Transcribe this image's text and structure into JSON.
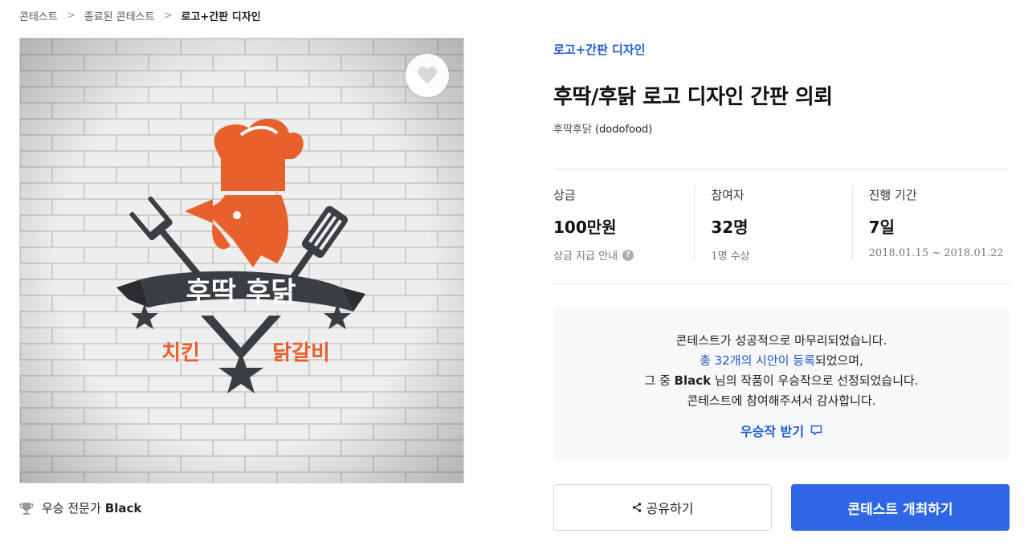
{
  "breadcrumb": {
    "items": [
      "콘테스트",
      "종료된 콘테스트",
      "로고+간판 디자인"
    ]
  },
  "image": {
    "logo_main": "후딱 후닭",
    "logo_left": "치킨",
    "logo_right": "닭갈비"
  },
  "winner": {
    "label": "우승 전문가",
    "name": "Black"
  },
  "contest": {
    "category": "로고+간판 디자인",
    "title": "후딱/후닭 로고 디자인 간판 의뢰",
    "host_name": "후딱후닭",
    "host_id": "(dodofood)"
  },
  "stats": {
    "prize_label": "상금",
    "prize_value": "100만원",
    "prize_sub": "상금 지급 안내",
    "participants_label": "참여자",
    "participants_value": "32명",
    "participants_sub": "1명 수상",
    "period_label": "진행 기간",
    "period_value": "7일",
    "period_sub": "2018.01.15 ~ 2018.01.22"
  },
  "notice": {
    "line1": "콘테스트가 성공적으로 마무리되었습니다.",
    "line2_blue": "총 32개의 시안이 등록",
    "line2_rest": "되었으며,",
    "line3_pre": "그 중 ",
    "line3_name": "Black",
    "line3_post": " 님의 작품이 우승작으로 선정되었습니다.",
    "line4": "콘테스트에 참여해주셔서 감사합니다.",
    "receive_label": "우승작 받기"
  },
  "actions": {
    "share_label": "공유하기",
    "host_label": "콘테스트 개최하기"
  },
  "colors": {
    "accent": "#2f66e6",
    "link": "#1f5bd6",
    "logo_orange": "#e8602c",
    "logo_dark": "#3a3d42"
  }
}
